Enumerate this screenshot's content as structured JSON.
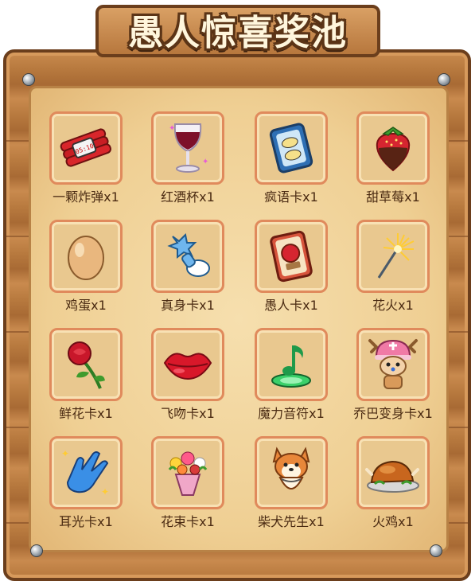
{
  "title": "愚人惊喜奖池",
  "items": [
    {
      "label": "一颗炸弹x1",
      "icon": "dynamite-icon"
    },
    {
      "label": "红酒杯x1",
      "icon": "wine-glass-icon"
    },
    {
      "label": "疯语卡x1",
      "icon": "crazy-words-card-icon"
    },
    {
      "label": "甜草莓x1",
      "icon": "strawberry-icon"
    },
    {
      "label": "鸡蛋x1",
      "icon": "egg-icon"
    },
    {
      "label": "真身卡x1",
      "icon": "true-form-card-icon"
    },
    {
      "label": "愚人卡x1",
      "icon": "fool-card-icon"
    },
    {
      "label": "花火x1",
      "icon": "sparkler-icon"
    },
    {
      "label": "鲜花卡x1",
      "icon": "rose-icon"
    },
    {
      "label": "飞吻卡x1",
      "icon": "lips-icon"
    },
    {
      "label": "魔力音符x1",
      "icon": "music-note-icon"
    },
    {
      "label": "乔巴变身卡x1",
      "icon": "chopper-icon"
    },
    {
      "label": "耳光卡x1",
      "icon": "slap-hand-icon"
    },
    {
      "label": "花束卡x1",
      "icon": "bouquet-icon"
    },
    {
      "label": "柴犬先生x1",
      "icon": "shiba-dog-icon"
    },
    {
      "label": "火鸡x1",
      "icon": "roast-turkey-icon"
    }
  ]
}
